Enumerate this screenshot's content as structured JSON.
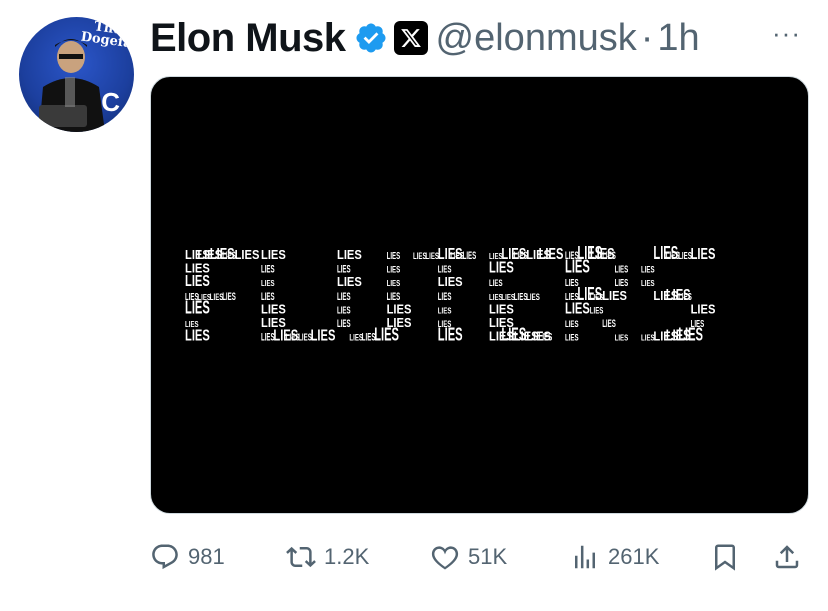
{
  "author": {
    "display_name": "Elon Musk",
    "handle": "@elonmusk",
    "separator": "·",
    "time": "1h",
    "avatar_lettering": "The Dogefa",
    "avatar_letter": "C"
  },
  "media": {
    "background": "#000000",
    "word": "LIES",
    "letter_shapes": [
      "F",
      "L",
      "U",
      "T",
      "E",
      "R",
      "S"
    ]
  },
  "actions": {
    "replies": "981",
    "reposts": "1.2K",
    "likes": "51K",
    "views": "261K"
  },
  "colors": {
    "verified_blue": "#1d9bf0",
    "muted": "#536471",
    "text": "#0f1419"
  },
  "icons": [
    "verified-badge-icon",
    "x-logo-icon",
    "more-icon",
    "reply-icon",
    "repost-icon",
    "like-icon",
    "views-icon",
    "bookmark-icon",
    "share-icon"
  ]
}
